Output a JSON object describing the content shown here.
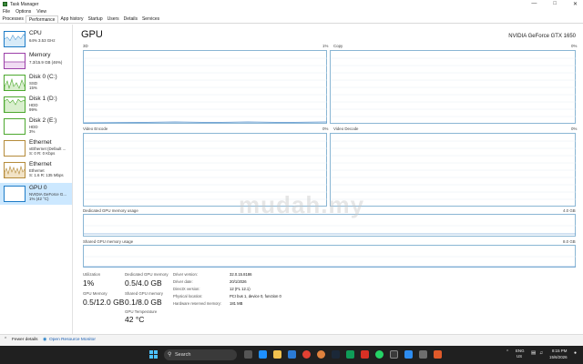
{
  "window": {
    "title": "Task Manager"
  },
  "menubar": [
    "File",
    "Options",
    "View"
  ],
  "tabs": [
    "Processes",
    "Performance",
    "App history",
    "Startup",
    "Users",
    "Details",
    "Services"
  ],
  "sidebar": {
    "items": [
      {
        "title": "CPU",
        "sub1": "64%  3.53 GHz",
        "sub2": "",
        "sub3": "",
        "border": "#1e7cc7"
      },
      {
        "title": "Memory",
        "sub1": "7.3/15.9 GB (46%)",
        "sub2": "",
        "sub3": "",
        "border": "#9b3fa8"
      },
      {
        "title": "Disk 0 (C:)",
        "sub1": "SSD",
        "sub2": "15%",
        "sub3": "",
        "border": "#4ca82e"
      },
      {
        "title": "Disk 1 (D:)",
        "sub1": "HDD",
        "sub2": "99%",
        "sub3": "",
        "border": "#4ca82e"
      },
      {
        "title": "Disk 2 (E:)",
        "sub1": "HDD",
        "sub2": "3%",
        "sub3": "",
        "border": "#4ca82e"
      },
      {
        "title": "Ethernet",
        "sub1": "vEthernet (Default ...",
        "sub2": "S: 0  R: 0 Kbps",
        "sub3": "",
        "border": "#b58b3a"
      },
      {
        "title": "Ethernet",
        "sub1": "Ethernet",
        "sub2": "S: 1.6  R: 135 Mbps",
        "sub3": "",
        "border": "#b58b3a"
      },
      {
        "title": "GPU 0",
        "sub1": "NVIDIA GeForce G...",
        "sub2": "1% (42 °C)",
        "sub3": "",
        "border": "#1e7cc7"
      }
    ]
  },
  "main": {
    "title": "GPU",
    "model": "NVIDIA GeForce GTX 1650",
    "graphs": {
      "g3d": {
        "label": "3D",
        "pct": "1%"
      },
      "copy": {
        "label": "Copy",
        "pct": "0%"
      },
      "encode": {
        "label": "Video Encode",
        "pct": "0%"
      },
      "decode": {
        "label": "Video Decode",
        "pct": "0%"
      },
      "dedicated": {
        "label": "Dedicated GPU memory usage",
        "max": "4.0 GB"
      },
      "shared": {
        "label": "Shared GPU memory usage",
        "max": "8.0 GB"
      }
    }
  },
  "stats": {
    "utilization_label": "Utilization",
    "utilization": "1%",
    "dedicated_label": "Dedicated GPU memory",
    "dedicated": "0.5/4.0 GB",
    "gpu_memory_label": "GPU Memory",
    "gpu_memory": "0.5/12.0 GB",
    "shared_label": "Shared GPU memory",
    "shared": "0.1/8.0 GB",
    "temp_label": "GPU Temperature",
    "temp": "42 °C",
    "kv": [
      {
        "k": "Driver version:",
        "v": "32.0.15.8186"
      },
      {
        "k": "Driver date:",
        "v": "20/1/2026"
      },
      {
        "k": "DirectX version:",
        "v": "12 (FL 12.1)"
      },
      {
        "k": "Physical location:",
        "v": "PCI bus 1, device 0, function 0"
      },
      {
        "k": "Hardware reserved memory:",
        "v": "181 MB"
      }
    ]
  },
  "footer": {
    "fewer": "Fewer details",
    "monitor": "Open Resource Monitor"
  },
  "taskbar": {
    "search": "Search",
    "lang1": "ENG",
    "lang2": "US",
    "time": "8:15 PM",
    "date": "15/6/2026"
  },
  "watermark": "mudah.my"
}
